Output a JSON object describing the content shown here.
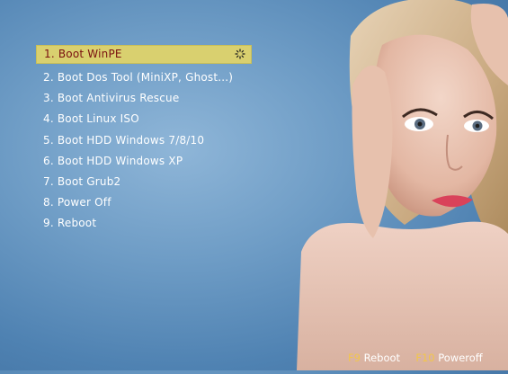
{
  "menu": {
    "items": [
      {
        "label": "1. Boot WinPE",
        "selected": true
      },
      {
        "label": "2. Boot Dos Tool (MiniXP, Ghost...)"
      },
      {
        "label": "3. Boot Antivirus Rescue"
      },
      {
        "label": "4. Boot Linux ISO"
      },
      {
        "label": "5. Boot HDD Windows 7/8/10"
      },
      {
        "label": "6. Boot HDD Windows XP"
      },
      {
        "label": "7. Boot Grub2"
      },
      {
        "label": "8. Power Off"
      },
      {
        "label": "9. Reboot"
      }
    ]
  },
  "footer": {
    "reboot_key": "F9",
    "reboot_label": "Reboot",
    "poweroff_key": "F10",
    "poweroff_label": "Poweroff"
  },
  "colors": {
    "background": "#5f90be",
    "highlight_bar": "#d9d06f",
    "highlight_text": "#7a1010",
    "menu_text": "#ffffff",
    "hotkey": "#f2c64a"
  },
  "icons": {
    "selected_indicator": "spinner-icon"
  }
}
